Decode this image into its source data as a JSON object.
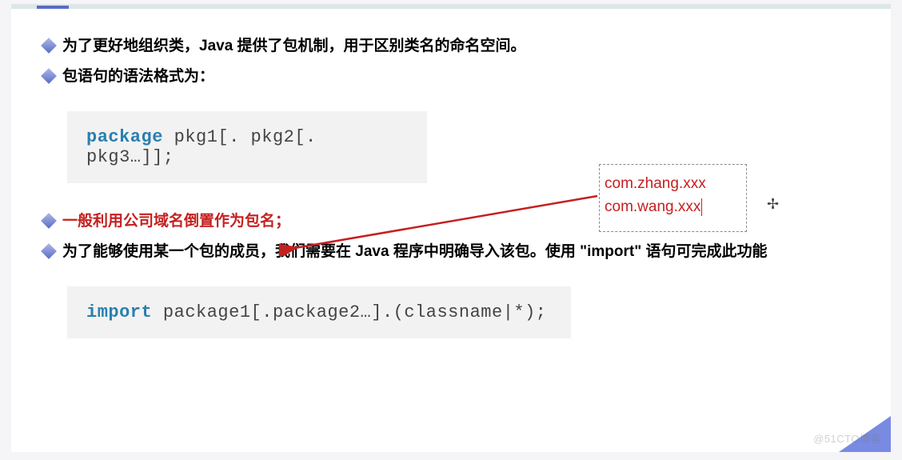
{
  "bullets": {
    "b1": "为了更好地组织类，Java 提供了包机制，用于区别类名的命名空间。",
    "b2": "包语句的语法格式为：",
    "b3": "一般利用公司域名倒置作为包名；",
    "b4": "为了能够使用某一个包的成员，我们需要在 Java 程序中明确导入该包。使用 \"import\" 语句可完成此功能"
  },
  "code1": {
    "kw": "package",
    "rest": " pkg1[. pkg2[. pkg3…]];"
  },
  "code2": {
    "kw": "import",
    "rest": " package1[.package2…].(classname|*);"
  },
  "example": {
    "line1": "com.zhang.xxx",
    "line2": "com.wang.xxx"
  },
  "watermark": "@51CTO博客"
}
